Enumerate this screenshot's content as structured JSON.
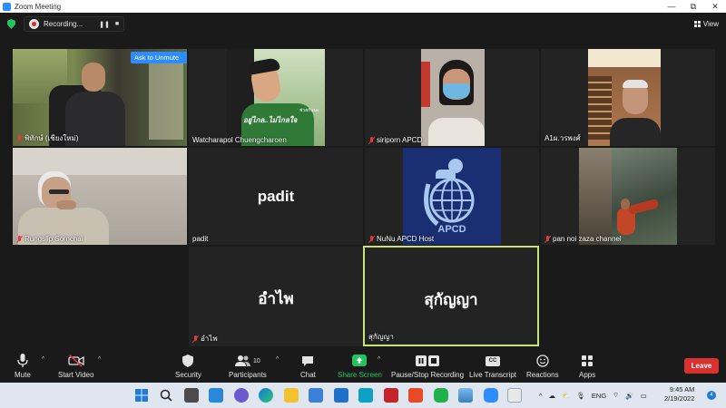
{
  "window": {
    "title": "Zoom Meeting",
    "min": "—",
    "restore": "⧉",
    "close": "✕"
  },
  "recording": {
    "label": "Recording...",
    "pause": "❚❚",
    "stop": "■"
  },
  "view": {
    "label": "View"
  },
  "tiles": [
    {
      "name": "พิทักษ์ (เชียงใหม่)",
      "muted": true
    },
    {
      "name": "Watcharapol Chuengcharoen",
      "muted": false,
      "caption": "อยู่ไกล..ไม่ไกลใจ",
      "caption_small": "ช่วยกันนะ"
    },
    {
      "name": "siriporn APCD",
      "muted": true
    },
    {
      "name": "A1ผ.วรพงศ์",
      "muted": false
    },
    {
      "name": "Rungslip Somchai",
      "muted": true
    },
    {
      "name": "padit",
      "muted": false,
      "big": "padit"
    },
    {
      "name": "NuNu APCD Host",
      "muted": true,
      "logo_text": "APCD"
    },
    {
      "name": "pan noi zaza channel",
      "muted": true
    },
    {
      "name": "อำไพ",
      "muted": true,
      "big": "อำไพ"
    },
    {
      "name": "สุกัญญา",
      "muted": false,
      "big": "สุกัญญา"
    }
  ],
  "overlay": {
    "ask_to_unmute": "Ask to Unmute",
    "more": "···"
  },
  "toolbar": {
    "mute": "Mute",
    "start_video": "Start Video",
    "security": "Security",
    "participants": "Participants",
    "participant_count": "10",
    "chat": "Chat",
    "share_screen": "Share Screen",
    "pause_stop": "Pause/Stop Recording",
    "live_transcript": "Live Transcript",
    "reactions": "Reactions",
    "apps": "Apps",
    "leave": "Leave",
    "cc": "CC"
  },
  "colors": {
    "accent": "#2d8cff",
    "leave": "#d93030",
    "active_speaker": "#c9e27a",
    "share": "#23c45e"
  },
  "taskbar": {
    "lang": "ENG",
    "time": "9:45 AM",
    "date": "2/19/2022",
    "badge": "4"
  }
}
